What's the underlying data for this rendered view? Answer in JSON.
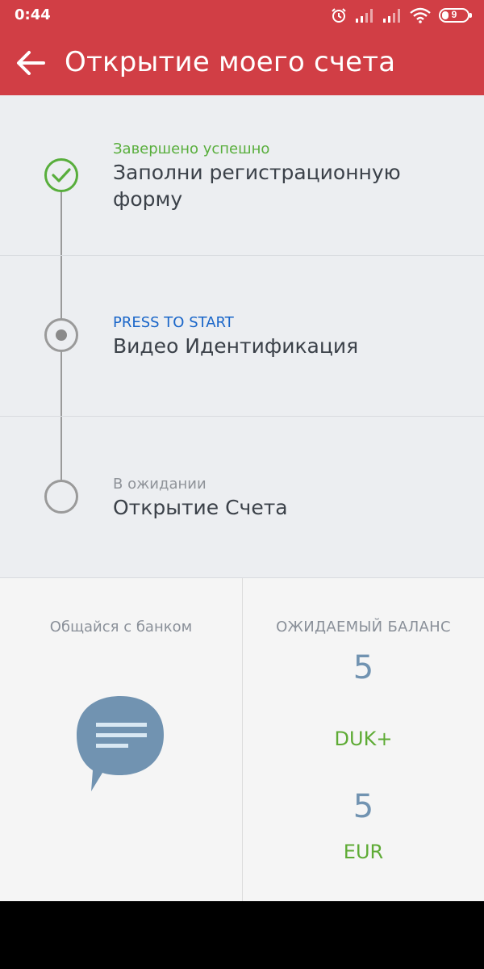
{
  "statusbar": {
    "time": "0:44",
    "battery": "9"
  },
  "appbar": {
    "title": "Открытие моего счета"
  },
  "steps": [
    {
      "status": "Завершено успешно",
      "status_color": "#58ae3c",
      "label": "Заполни регистрационную форму",
      "state": "done"
    },
    {
      "status": "PRESS TO START",
      "status_color": "#1a66c9",
      "label": "Видео Идентификация",
      "state": "active"
    },
    {
      "status": "В ожидании",
      "status_color": "#8f9399",
      "label": "Открытие Счета",
      "state": "pending"
    }
  ],
  "chat": {
    "label": "Общайся с банком",
    "icon": "chat-bubble-icon"
  },
  "balance": {
    "title": "ОЖИДАЕМЫЙ БАЛАНС",
    "items": [
      {
        "value": "5",
        "currency": "DUK+"
      },
      {
        "value": "5",
        "currency": "EUR"
      }
    ]
  },
  "colors": {
    "brand": "#d13e45",
    "success": "#58ae3c",
    "link": "#1a66c9",
    "value": "#7193b1"
  }
}
